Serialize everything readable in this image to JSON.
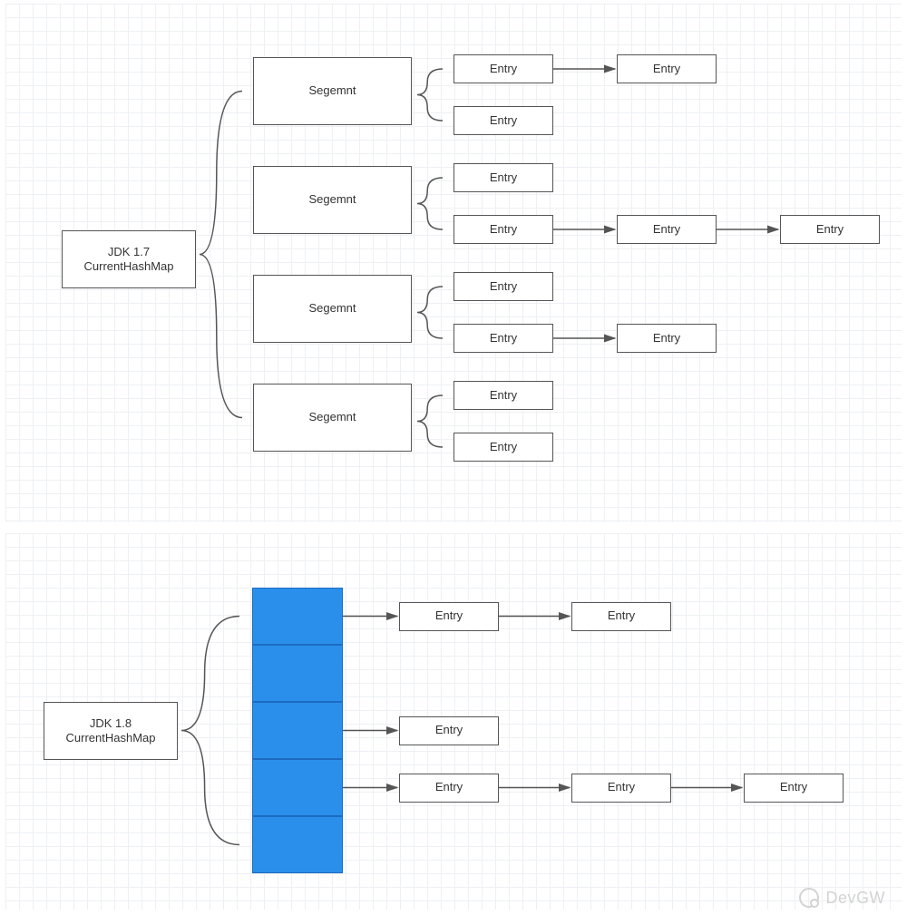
{
  "watermark": "DevGW",
  "colors": {
    "bucket_fill": "#2A8FEA",
    "bucket_stroke": "#1c6bc0"
  },
  "jdk17": {
    "root_label": "JDK 1.7\nCurrentHashMap",
    "segment_label": "Segemnt",
    "entry_label": "Entry",
    "segments": [
      {
        "rows": [
          {
            "chain_length": 2
          },
          {
            "chain_length": 1
          }
        ]
      },
      {
        "rows": [
          {
            "chain_length": 1
          },
          {
            "chain_length": 3
          }
        ]
      },
      {
        "rows": [
          {
            "chain_length": 1
          },
          {
            "chain_length": 2
          }
        ]
      },
      {
        "rows": [
          {
            "chain_length": 1
          },
          {
            "chain_length": 1
          }
        ]
      }
    ]
  },
  "jdk18": {
    "root_label": "JDK 1.8\nCurrentHashMap",
    "entry_label": "Entry",
    "bucket_count": 5,
    "rows": [
      {
        "bucket_index": 0,
        "chain_length": 2
      },
      {
        "bucket_index": 2,
        "chain_length": 1
      },
      {
        "bucket_index": 3,
        "chain_length": 3
      }
    ]
  }
}
